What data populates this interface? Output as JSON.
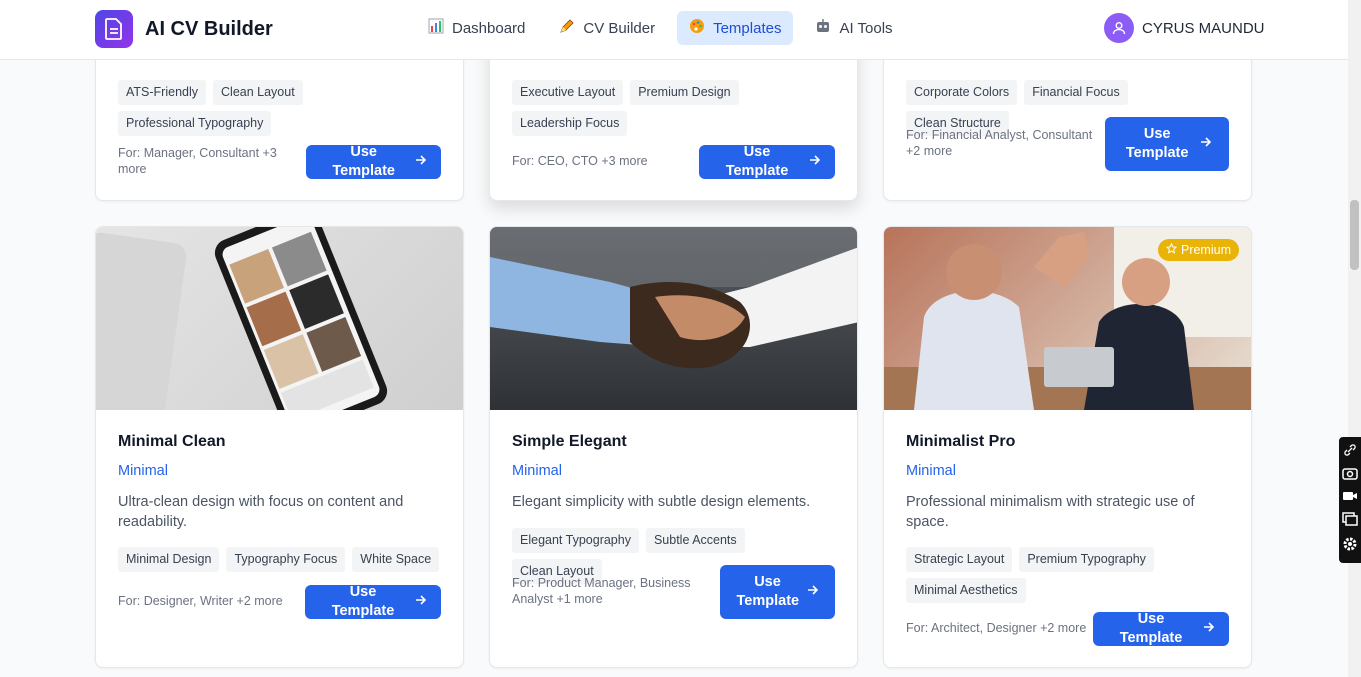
{
  "nav": {
    "app_title": "AI CV Builder",
    "links": [
      {
        "label": "Dashboard",
        "icon": "bar-chart-icon"
      },
      {
        "label": "CV Builder",
        "icon": "pencil-icon"
      },
      {
        "label": "Templates",
        "icon": "palette-icon"
      },
      {
        "label": "AI Tools",
        "icon": "robot-icon"
      }
    ],
    "active": "Templates",
    "user_name": "CYRUS MAUNDU"
  },
  "top_cards": [
    {
      "tags": [
        "ATS-Friendly",
        "Clean Layout",
        "Professional Typography"
      ],
      "for": "For: Manager, Consultant +3 more",
      "button": "Use Template"
    },
    {
      "tags": [
        "Executive Layout",
        "Premium Design",
        "Leadership Focus"
      ],
      "for": "For: CEO, CTO +3 more",
      "button": "Use Template"
    },
    {
      "tags": [
        "Corporate Colors",
        "Financial Focus",
        "Clean Structure"
      ],
      "for": "For: Financial Analyst, Consultant +2 more",
      "button": "Use Template"
    }
  ],
  "cards": [
    {
      "title": "Minimal Clean",
      "category": "Minimal",
      "description": "Ultra-clean design with focus on content and readability.",
      "tags": [
        "Minimal Design",
        "Typography Focus",
        "White Space"
      ],
      "for": "For: Designer, Writer +2 more",
      "button": "Use Template"
    },
    {
      "title": "Simple Elegant",
      "category": "Minimal",
      "description": "Elegant simplicity with subtle design elements.",
      "tags": [
        "Elegant Typography",
        "Subtle Accents",
        "Clean Layout"
      ],
      "for": "For: Product Manager, Business Analyst +1 more",
      "button": "Use Template"
    },
    {
      "title": "Minimalist Pro",
      "category": "Minimal",
      "description": "Professional minimalism with strategic use of space.",
      "tags": [
        "Strategic Layout",
        "Premium Typography",
        "Minimal Aesthetics"
      ],
      "for": "For: Architect, Designer +2 more",
      "button": "Use Template",
      "badge": "Premium"
    }
  ],
  "colors": {
    "accent": "#2563eb",
    "premium": "#eab308",
    "logo_from": "#4f46e5",
    "logo_to": "#9333ea"
  }
}
